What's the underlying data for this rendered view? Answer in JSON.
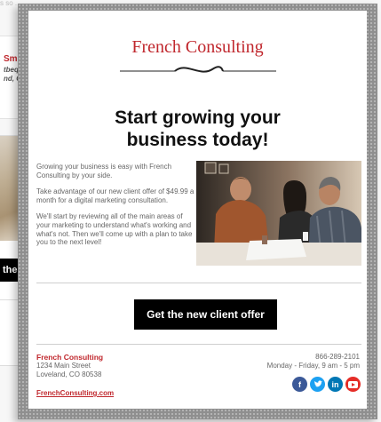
{
  "background": {
    "top_text": "s so ...   ...  ...",
    "card1": {
      "name": "Smit",
      "address_line1": "tbequ",
      "address_line2": "nd, C"
    },
    "card2": {
      "button_label": "the"
    }
  },
  "email": {
    "brand": "French Consulting",
    "headline_line1": "Start growing your",
    "headline_line2": "business today!",
    "paragraphs": [
      "Growing your business is easy with French Consulting by your side.",
      "Take advantage of our new client offer of $49.99 a month for a digital marketing consultation.",
      "We'll start by reviewing all of the main areas of your marketing to understand what's working and what's not. Then we'll come up with a plan to take you to the next level!"
    ],
    "cta_label": "Get the new client offer",
    "footer": {
      "company": "French Consulting",
      "street": "1234 Main Street",
      "city": "Loveland, CO 80538",
      "website": "FrenchConsulting.com",
      "phone": "866-289-2101",
      "hours": "Monday - Friday, 9 am - 5 pm"
    },
    "social_icons": [
      {
        "icon": "facebook-icon",
        "glyph": "f",
        "color": "#3b5998"
      },
      {
        "icon": "twitter-icon",
        "glyph": "",
        "color": "#1da1f2"
      },
      {
        "icon": "linkedin-icon",
        "glyph": "in",
        "color": "#0077b5"
      },
      {
        "icon": "youtube-icon",
        "glyph": "",
        "color": "#e52d27"
      }
    ]
  },
  "colors": {
    "brand_red": "#c0272d",
    "cta_background": "#000000",
    "frame_gray": "#8f8f8f"
  }
}
